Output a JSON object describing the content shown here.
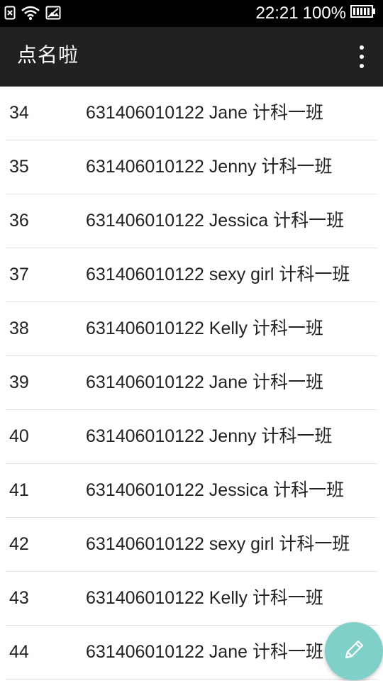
{
  "status_bar": {
    "time": "22:21",
    "battery": "100%",
    "icons": [
      "sim-error-icon",
      "wifi-icon",
      "image-icon",
      "battery-icon"
    ]
  },
  "app_bar": {
    "title": "点名啦",
    "overflow_icon": "more-vert-icon"
  },
  "list": [
    {
      "num": "34",
      "info": "631406010122 Jane 计科一班"
    },
    {
      "num": "35",
      "info": "631406010122 Jenny 计科一班"
    },
    {
      "num": "36",
      "info": "631406010122 Jessica 计科一班"
    },
    {
      "num": "37",
      "info": "631406010122 sexy girl 计科一班"
    },
    {
      "num": "38",
      "info": "631406010122 Kelly 计科一班"
    },
    {
      "num": "39",
      "info": "631406010122 Jane 计科一班"
    },
    {
      "num": "40",
      "info": "631406010122 Jenny 计科一班"
    },
    {
      "num": "41",
      "info": "631406010122 Jessica 计科一班"
    },
    {
      "num": "42",
      "info": "631406010122 sexy girl 计科一班"
    },
    {
      "num": "43",
      "info": "631406010122 Kelly 计科一班"
    },
    {
      "num": "44",
      "info": "631406010122 Jane 计科一班"
    }
  ],
  "fab": {
    "icon": "pencil-icon",
    "color": "#7fd0c8"
  },
  "colors": {
    "status_bar": "#000000",
    "app_bar": "#212121",
    "divider": "#e3e3e3"
  }
}
